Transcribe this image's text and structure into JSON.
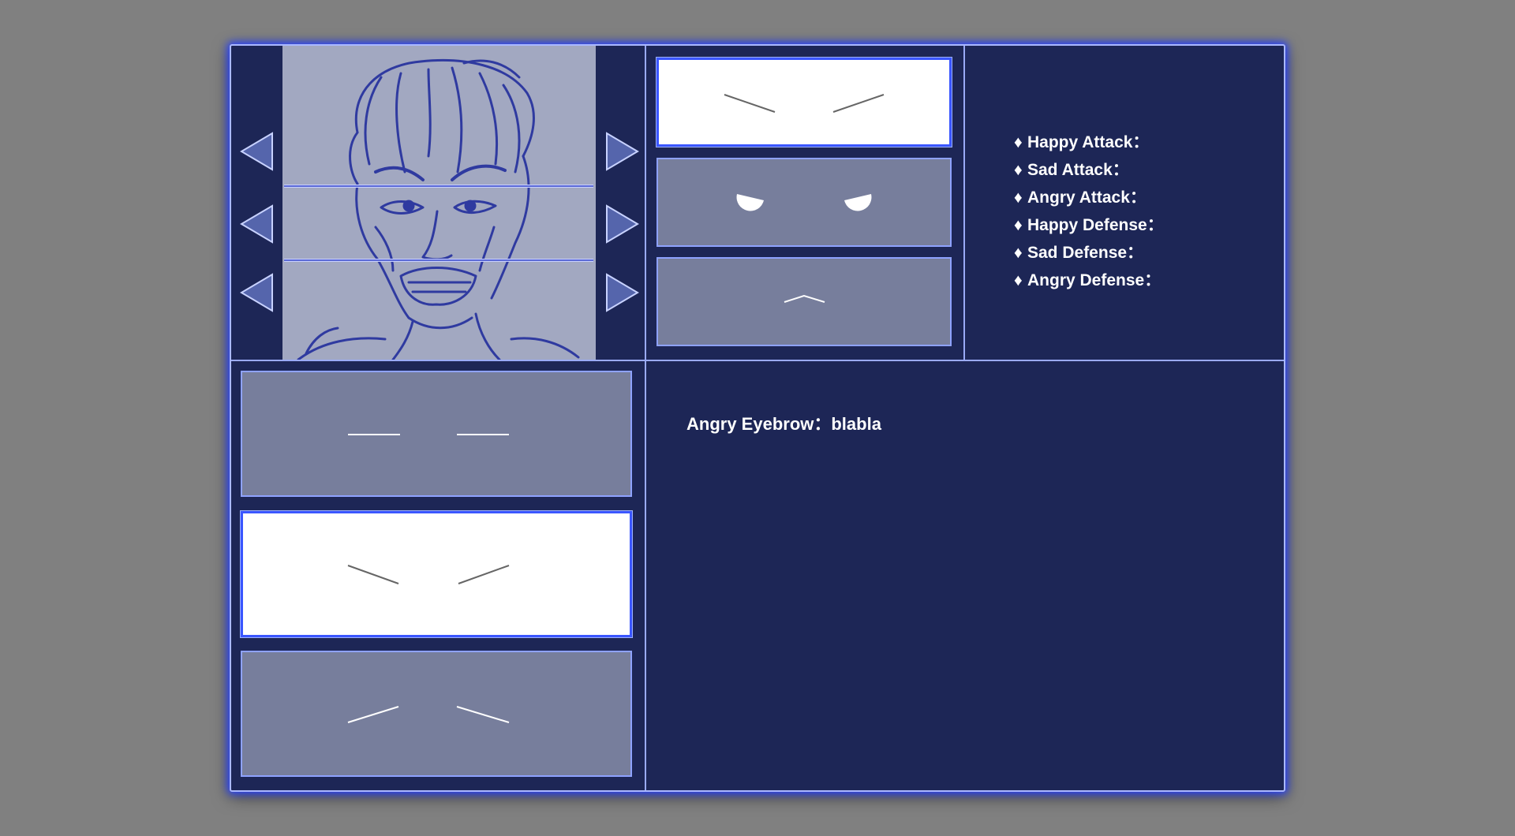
{
  "colors": {
    "page_background": "#808080",
    "panel_background": "#1d2656",
    "panel_border": "#aab8ff",
    "tile_default": "#777e9c",
    "tile_selected": "#ffffff",
    "arrow_fill": "#5565ac",
    "face_background": "#a2a8c1",
    "sketch_stroke": "#2f3aa0"
  },
  "face_view": {
    "arrows_left": [
      "arrow-left-icon",
      "arrow-left-icon",
      "arrow-left-icon"
    ],
    "arrows_right": [
      "arrow-right-icon",
      "arrow-right-icon",
      "arrow-right-icon"
    ]
  },
  "feature_options_top": [
    {
      "feature": "eyebrows",
      "style": "angry",
      "selected": true
    },
    {
      "feature": "eyes",
      "style": "angry",
      "selected": false
    },
    {
      "feature": "mouth",
      "style": "small-frown",
      "selected": false
    }
  ],
  "eyebrow_options": [
    {
      "style": "neutral",
      "selected": false
    },
    {
      "style": "angry",
      "selected": true
    },
    {
      "style": "sad",
      "selected": false
    }
  ],
  "stats": {
    "bullet": "♦",
    "items": [
      {
        "label": "Happy Attack："
      },
      {
        "label": "Sad Attack："
      },
      {
        "label": "Angry Attack："
      },
      {
        "label": "Happy Defense："
      },
      {
        "label": "Sad Defense："
      },
      {
        "label": "Angry Defense："
      }
    ]
  },
  "description": {
    "text": "Angry Eyebrow：blabla"
  }
}
